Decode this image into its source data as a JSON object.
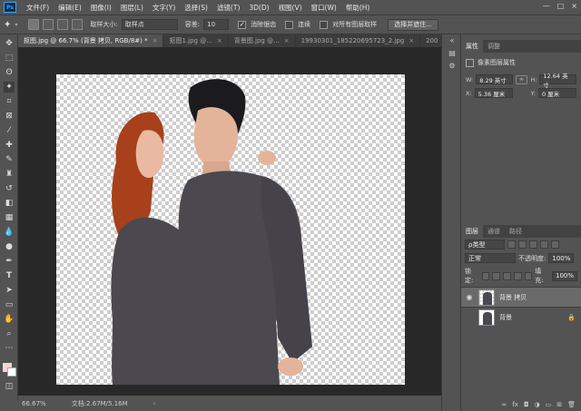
{
  "app": {
    "logo": "Ps"
  },
  "menu": [
    "文件(F)",
    "编辑(E)",
    "图像(I)",
    "图层(L)",
    "文字(Y)",
    "选择(S)",
    "滤镜(T)",
    "3D(D)",
    "视图(V)",
    "窗口(W)",
    "帮助(H)"
  ],
  "window_controls": {
    "minimize": "—",
    "maximize": "□",
    "close": "×"
  },
  "options": {
    "sample_size_label": "取样大小:",
    "sample_size_value": "取样点",
    "tolerance_label": "容差:",
    "tolerance_value": "10",
    "antialias_label": "消除锯齿",
    "contiguous_label": "连续",
    "all_layers_label": "对所有图层取样",
    "select_subject_label": "选择并遮住..."
  },
  "tabs": [
    {
      "label": "抠图.jpg @ 66.7% (背景 拷贝, RGB/8#) *",
      "close": "×"
    },
    {
      "label": "抠图1.jpg @...",
      "close": "×"
    },
    {
      "label": "背景图.jpg @...",
      "close": "×"
    },
    {
      "label": "19930301_185220695723_2.jpg",
      "close": "×"
    },
    {
      "label": "200",
      "close": ""
    }
  ],
  "status": {
    "zoom": "66.67%",
    "doc": "文档:2.67M/5.16M"
  },
  "properties": {
    "tabs": [
      "属性",
      "调整"
    ],
    "header": "像素图层属性",
    "w_label": "W:",
    "w_value": "8.29 英寸",
    "h_label": "H:",
    "h_value": "12.64 英寸",
    "x_label": "X:",
    "x_value": "5.36 厘米",
    "y_label": "Y:",
    "y_value": "0 厘米"
  },
  "layers": {
    "tabs": [
      "图层",
      "通道",
      "路径"
    ],
    "filter_value": "ρ类型",
    "blend_mode": "正常",
    "opacity_label": "不透明度:",
    "opacity_value": "100%",
    "lock_label": "锁定:",
    "fill_label": "填充:",
    "fill_value": "100%",
    "items": [
      {
        "name": "背景 拷贝",
        "visible": true,
        "locked": false
      },
      {
        "name": "背景",
        "visible": false,
        "locked": true
      }
    ]
  },
  "colors": {
    "accent": "#31a8ff",
    "panel": "#535353",
    "canvas_bg": "#282828",
    "shirt": "#4b4850",
    "hair": "#a8401c"
  }
}
